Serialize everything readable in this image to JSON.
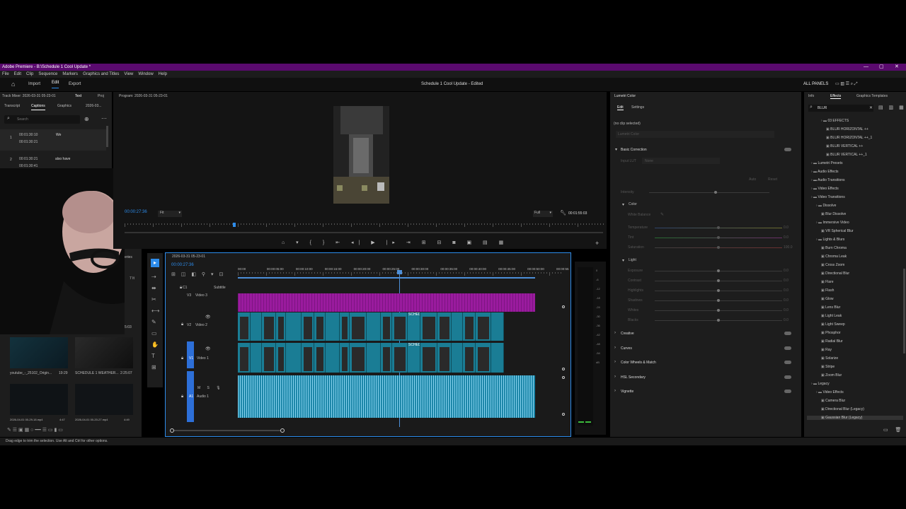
{
  "app": {
    "title": "Adobe Premiere - B:\\Schedule 1 Cool Update *",
    "center_title": "Schedule 1 Cool Update - Edited",
    "window_controls": [
      "—",
      "▢",
      "✕"
    ]
  },
  "menu": [
    "File",
    "Edit",
    "Clip",
    "Sequence",
    "Markers",
    "Graphics and Titles",
    "View",
    "Window",
    "Help"
  ],
  "workspace_tabs": [
    "Import",
    "Edit",
    "Export"
  ],
  "all_panels": "ALL PANELS",
  "left_panel": {
    "tabs_top": [
      "Track Mixer: 2026-03-31 05-23-01",
      "Text",
      "Proj"
    ],
    "tabs": [
      "Transcript",
      "Captions",
      "Graphics",
      "2026-03..."
    ],
    "search_placeholder": "Search",
    "captions": [
      {
        "num": "1",
        "start": "00:01:30:10",
        "end": "00:01:30:21",
        "text": "We"
      },
      {
        "num": "2",
        "start": "00:01:30:21",
        "end": "00:01:30:41",
        "text": "also have"
      }
    ],
    "side_label_1": "eries",
    "side_label_2": "7 It",
    "side_label_3": "5:03",
    "bins": [
      {
        "name": "youtube_-_25102_Origin...",
        "dur": "19:29"
      },
      {
        "name": "SCHEDULE 1 WEATHER...",
        "dur": "2:25:07"
      },
      {
        "name": "2026-04-01 00-29-18.mp4",
        "dur": "4:47"
      },
      {
        "name": "2026-04-01 00-20-27.mp4",
        "dur": "4:49"
      }
    ]
  },
  "program": {
    "tab": "Program: 2026-03-31 05-23-01",
    "timecode": "00:00:27:36",
    "fit": "Fit",
    "quality": "Full",
    "duration": "00:01:55:03"
  },
  "timeline": {
    "tab": "2026-03-31 05-23-01",
    "timecode": "00:00:27:36",
    "ruler": [
      "00:00",
      "00:00:05:00",
      "00:00:10:00",
      "00:00:15:00",
      "00:00:20:00",
      "00:00:25:00",
      "00:00:30:00",
      "00:00:35:00",
      "00:00:40:00",
      "00:00:45:00",
      "00:00:50:00",
      "00:00:55"
    ],
    "tracks": [
      {
        "id": "C1",
        "name": "Subtitle"
      },
      {
        "id": "V3",
        "name": "Video 3"
      },
      {
        "id": "V2",
        "name": "Video 2"
      },
      {
        "id": "V1",
        "name": "Video 1"
      },
      {
        "id": "A1",
        "name": "Audio 1"
      }
    ],
    "clip_label": "SCHEDULE",
    "meter_labels": [
      "0",
      "-6",
      "-12",
      "-18",
      "-24",
      "-30",
      "-36",
      "-42",
      "-48",
      "-54",
      "dB"
    ]
  },
  "lumetri": {
    "tab": "Lumetri Color",
    "subtabs": [
      "Edit",
      "Settings"
    ],
    "no_clip": "(no clip selected)",
    "dropdown": "Lumetri Color",
    "basic_correction": "Basic Correction",
    "input_lut": "Input LUT",
    "lut_value": "None",
    "auto": "Auto",
    "reset": "Reset",
    "intensity": "Intensity",
    "color": "Color",
    "white_balance": "White Balance",
    "color_sliders": [
      {
        "label": "Temperature",
        "value": "0.0"
      },
      {
        "label": "Tint",
        "value": "0.0"
      },
      {
        "label": "Saturation",
        "value": "100.0"
      }
    ],
    "light": "Light",
    "light_sliders": [
      {
        "label": "Exposure",
        "value": "0.0"
      },
      {
        "label": "Contrast",
        "value": "0.0"
      },
      {
        "label": "Highlights",
        "value": "0.0"
      },
      {
        "label": "Shadows",
        "value": "0.0"
      },
      {
        "label": "Whites",
        "value": "0.0"
      },
      {
        "label": "Blacks",
        "value": "0.0"
      }
    ],
    "sections": [
      "Creative",
      "Curves",
      "Color Wheels & Match",
      "HSL Secondary",
      "Vignette"
    ]
  },
  "effects": {
    "tabs": [
      "Info",
      "Effects",
      "Graphics Templates"
    ],
    "search_value": "BLUR",
    "tree": [
      {
        "indent": 2,
        "label": "03 EFFECTS",
        "type": "folder"
      },
      {
        "indent": 3,
        "label": "BLUR HORIZONTAL ++",
        "type": "item"
      },
      {
        "indent": 3,
        "label": "BLUR HORIZONTAL ++_1",
        "type": "item"
      },
      {
        "indent": 3,
        "label": "BLUR VERTICAL ++",
        "type": "item"
      },
      {
        "indent": 3,
        "label": "BLUR VERTICAL ++_1",
        "type": "item"
      },
      {
        "indent": 0,
        "label": "Lumetri Presets",
        "type": "folder"
      },
      {
        "indent": 0,
        "label": "Audio Effects",
        "type": "folder"
      },
      {
        "indent": 0,
        "label": "Audio Transitions",
        "type": "folder"
      },
      {
        "indent": 0,
        "label": "Video Effects",
        "type": "folder"
      },
      {
        "indent": 0,
        "label": "Video Transitions",
        "type": "folder"
      },
      {
        "indent": 1,
        "label": "Dissolve",
        "type": "folder"
      },
      {
        "indent": 2,
        "label": "Blur Dissolve",
        "type": "item"
      },
      {
        "indent": 1,
        "label": "Immersive Video",
        "type": "folder"
      },
      {
        "indent": 2,
        "label": "VR Spherical Blur",
        "type": "item"
      },
      {
        "indent": 1,
        "label": "Lights & Blurs",
        "type": "folder"
      },
      {
        "indent": 2,
        "label": "Burn Chroma",
        "type": "item"
      },
      {
        "indent": 2,
        "label": "Chroma Leak",
        "type": "item"
      },
      {
        "indent": 2,
        "label": "Cross Zoom",
        "type": "item"
      },
      {
        "indent": 2,
        "label": "Directional Blur",
        "type": "item"
      },
      {
        "indent": 2,
        "label": "Flare",
        "type": "item"
      },
      {
        "indent": 2,
        "label": "Flash",
        "type": "item"
      },
      {
        "indent": 2,
        "label": "Glow",
        "type": "item"
      },
      {
        "indent": 2,
        "label": "Lens Blur",
        "type": "item"
      },
      {
        "indent": 2,
        "label": "Light Leak",
        "type": "item"
      },
      {
        "indent": 2,
        "label": "Light Sweep",
        "type": "item"
      },
      {
        "indent": 2,
        "label": "Phosphor",
        "type": "item"
      },
      {
        "indent": 2,
        "label": "Radial Blur",
        "type": "item"
      },
      {
        "indent": 2,
        "label": "Ray",
        "type": "item"
      },
      {
        "indent": 2,
        "label": "Solarize",
        "type": "item"
      },
      {
        "indent": 2,
        "label": "Stripe",
        "type": "item"
      },
      {
        "indent": 2,
        "label": "Zoom Blur",
        "type": "item"
      },
      {
        "indent": 0,
        "label": "Legacy",
        "type": "folder"
      },
      {
        "indent": 1,
        "label": "Video Effects",
        "type": "folder"
      },
      {
        "indent": 2,
        "label": "Camera Blur",
        "type": "item"
      },
      {
        "indent": 2,
        "label": "Directional Blur (Legacy)",
        "type": "item"
      },
      {
        "indent": 2,
        "label": "Gaussian Blur (Legacy)",
        "type": "item"
      }
    ]
  },
  "status_bar": "Drag edge to trim the selection. Use Alt and Ctrl for other options.",
  "colors": {
    "accent": "#2d8ceb",
    "title_bar": "#5a0a6e",
    "subtitle_track": "#9a1b9e",
    "video_clip": "#1a7d95",
    "audio_clip": "#1d87a9"
  }
}
